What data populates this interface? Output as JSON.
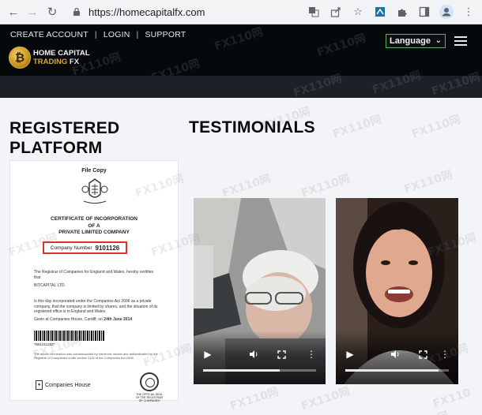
{
  "browser": {
    "url": "https://homecapitalfx.com",
    "icons": [
      "back-icon",
      "forward-icon",
      "reload-icon",
      "lock-icon",
      "translate-icon",
      "share-icon",
      "bookmark-star-icon",
      "extension-icon",
      "puzzle-icon",
      "sidebar-icon",
      "profile-icon",
      "menu-dots-icon"
    ]
  },
  "header": {
    "links": [
      "CREATE ACCOUNT",
      "LOGIN",
      "SUPPORT"
    ],
    "separator": "|",
    "logo": {
      "line1": "HOME CAPITAL",
      "line2": "TRADING",
      "line2_suffix": "FX",
      "coin_symbol": "₿"
    },
    "language_label": "Language"
  },
  "sections": {
    "registered_title_line1": "REGISTERED",
    "registered_title_line2": "PLATFORM",
    "testimonials_title": "TESTIMONIALS"
  },
  "certificate": {
    "file_copy": "File Copy",
    "title_line1": "CERTIFICATE OF INCORPORATION",
    "title_line2": "OF A",
    "title_line3": "PRIVATE LIMITED COMPANY",
    "company_number_label": "Company Number",
    "company_number": "9101126",
    "para1": "The Registrar of Companies for England and Wales, hereby certifies that",
    "company_name": "BITCAPITAL LTD.",
    "para2": "is this day incorporated under the Companies Act 2006 as a private company, that the company is limited by shares, and the situation of its registered office is in England and Wales",
    "given_at_prefix": "Given at Companies House, Cardiff, on",
    "given_at_date": "24th June 2014",
    "barcode_number": "*N9101126Z*",
    "fine_print": "The above information was communicated by electronic means and authenticated by the Registrar of Companies under section 1115 of the Companies Act 2006",
    "footer_org": "Companies House",
    "seal_caption": "THE OFFICIAL SEAL OF THE REGISTRAR OF COMPANIES"
  },
  "videos": [
    {
      "progress": 0.68
    },
    {
      "progress": 0.9
    }
  ],
  "watermark": "FX110网",
  "colors": {
    "header_bg": "#06090b",
    "band_bg": "#1c2127",
    "accent_gold": "#d7a83a",
    "lang_border": "#59b46a",
    "highlight_red": "#d9302c"
  }
}
